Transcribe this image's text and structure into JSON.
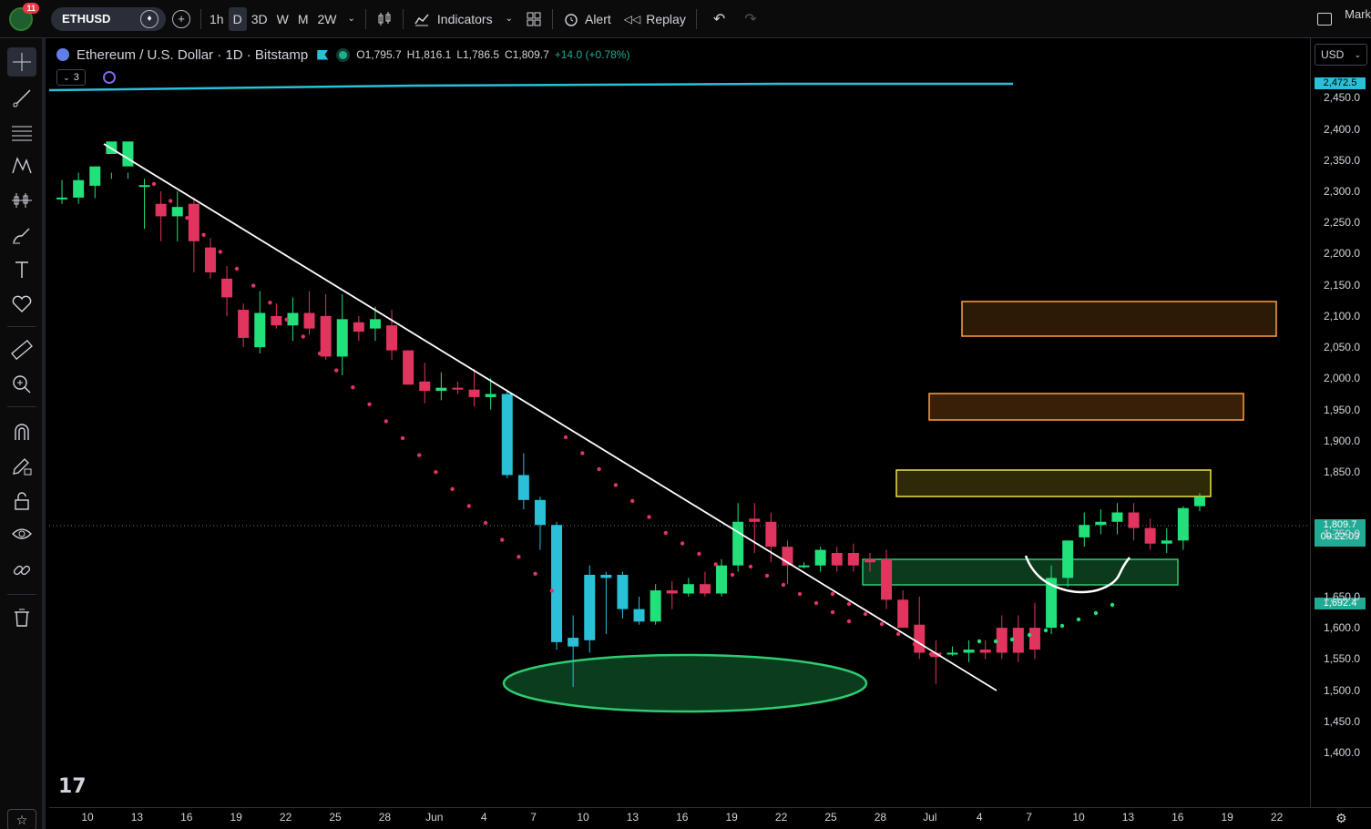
{
  "toolbar": {
    "notif_count": "11",
    "symbol": "ETHUSD",
    "timeframes": [
      "1h",
      "D",
      "3D",
      "W",
      "M",
      "2W"
    ],
    "active_timeframe": "D",
    "indicators_label": "Indicators",
    "alert_label": "Alert",
    "replay_label": "Replay",
    "right_label": "Mark"
  },
  "legend": {
    "title": "Ethereum / U.S. Dollar · 1D · Bitstamp",
    "open": "O1,795.7",
    "high": "H1,816.1",
    "low": "L1,786.5",
    "close": "C1,809.7",
    "change": "+14.0 (+0.78%)",
    "indicator_count": "3"
  },
  "currency": "USD",
  "price_axis": {
    "labels": [
      "2,450.0",
      "2,400.0",
      "2,350.0",
      "2,300.0",
      "2,250.0",
      "2,200.0",
      "2,150.0",
      "2,100.0",
      "2,050.0",
      "2,000.0",
      "1,950.0",
      "1,900.0",
      "1,850.0",
      "1,750.0",
      "1,650.0",
      "1,600.0",
      "1,550.0",
      "1,500.0",
      "1,450.0",
      "1,400.0"
    ],
    "tag_top": "2,472.5",
    "tag_price": "1,809.7",
    "tag_countdown": "09:22:09",
    "tag_low": "1,692.4"
  },
  "time_axis": [
    "10",
    "13",
    "16",
    "19",
    "22",
    "25",
    "28",
    "Jun",
    "4",
    "7",
    "10",
    "13",
    "16",
    "19",
    "22",
    "25",
    "28",
    "Jul",
    "4",
    "7",
    "10",
    "13",
    "16",
    "19",
    "22"
  ],
  "colors": {
    "up": "#22e07a",
    "down": "#e0355f",
    "up_blue": "#2ac1d8",
    "bg": "#000000",
    "ellipse": "#2ecc71",
    "zone_orange": "#ff9f43",
    "zone_yellow": "#f1e04a",
    "zone_green": "#2ecc71"
  },
  "chart_data": {
    "type": "candlestick",
    "ylim": [
      1380,
      2520
    ],
    "candles": [
      [
        1,
        2290,
        2290,
        2280,
        2318
      ],
      [
        2,
        2290,
        2318,
        2280,
        2330
      ],
      [
        3,
        2309,
        2340,
        2289,
        2340
      ],
      [
        4,
        2360,
        2380,
        2320,
        2330
      ],
      [
        5,
        2340,
        2380,
        2320,
        2330
      ],
      [
        6,
        2310,
        2310,
        2240,
        2320
      ],
      [
        7,
        2280,
        2260,
        2220,
        2300
      ],
      [
        8,
        2260,
        2275,
        2220,
        2300
      ],
      [
        9,
        2280,
        2220,
        2170,
        2290
      ],
      [
        10,
        2210,
        2170,
        2160,
        2225
      ],
      [
        11,
        2160,
        2130,
        2100,
        2180
      ],
      [
        12,
        2110,
        2065,
        2050,
        2120
      ],
      [
        13,
        2050,
        2105,
        2040,
        2140
      ],
      [
        14,
        2100,
        2085,
        2080,
        2120
      ],
      [
        15,
        2085,
        2105,
        2060,
        2130
      ],
      [
        16,
        2105,
        2080,
        2070,
        2140
      ],
      [
        17,
        2100,
        2035,
        2030,
        2135
      ],
      [
        18,
        2035,
        2095,
        2005,
        2135
      ],
      [
        19,
        2090,
        2075,
        2060,
        2100
      ],
      [
        20,
        2080,
        2095,
        2060,
        2115
      ],
      [
        21,
        2085,
        2045,
        2030,
        2110
      ],
      [
        22,
        2045,
        1990,
        1995,
        2045
      ],
      [
        23,
        1995,
        1980,
        1960,
        2025
      ],
      [
        24,
        1980,
        1985,
        1965,
        2010
      ],
      [
        25,
        1985,
        1982,
        1975,
        1995
      ],
      [
        26,
        1982,
        1970,
        1955,
        2015
      ],
      [
        27,
        1970,
        1975,
        1950,
        2000
      ],
      [
        28,
        1975,
        1845,
        1840,
        1980
      ],
      [
        29,
        1845,
        1805,
        1790,
        1880
      ],
      [
        30,
        1805,
        1765,
        1725,
        1810
      ],
      [
        31,
        1765,
        1577,
        1565,
        1770
      ],
      [
        32,
        1570,
        1584,
        1505,
        1620
      ],
      [
        33,
        1580,
        1685,
        1560,
        1700
      ],
      [
        34,
        1680,
        1685,
        1590,
        1690
      ],
      [
        35,
        1685,
        1630,
        1615,
        1690
      ],
      [
        36,
        1630,
        1610,
        1605,
        1650
      ],
      [
        37,
        1610,
        1660,
        1605,
        1670
      ],
      [
        38,
        1660,
        1655,
        1630,
        1675
      ],
      [
        39,
        1655,
        1670,
        1650,
        1680
      ],
      [
        40,
        1670,
        1655,
        1650,
        1690
      ],
      [
        41,
        1655,
        1700,
        1650,
        1710
      ],
      [
        42,
        1700,
        1770,
        1690,
        1800
      ],
      [
        43,
        1775,
        1770,
        1720,
        1800
      ],
      [
        44,
        1770,
        1730,
        1705,
        1785
      ],
      [
        45,
        1730,
        1700,
        1670,
        1740
      ],
      [
        46,
        1700,
        1700,
        1695,
        1705
      ],
      [
        47,
        1700,
        1725,
        1690,
        1730
      ],
      [
        48,
        1720,
        1700,
        1690,
        1730
      ],
      [
        49,
        1720,
        1700,
        1690,
        1735
      ],
      [
        50,
        1710,
        1705,
        1690,
        1720
      ],
      [
        51,
        1710,
        1645,
        1630,
        1725
      ],
      [
        52,
        1645,
        1600,
        1600,
        1660
      ],
      [
        53,
        1605,
        1560,
        1550,
        1650
      ],
      [
        54,
        1560,
        1553,
        1510,
        1580
      ],
      [
        55,
        1560,
        1560,
        1555,
        1570
      ],
      [
        56,
        1560,
        1565,
        1545,
        1580
      ],
      [
        57,
        1565,
        1560,
        1550,
        1580
      ],
      [
        58,
        1600,
        1560,
        1550,
        1620
      ],
      [
        59,
        1600,
        1560,
        1545,
        1620
      ],
      [
        60,
        1600,
        1565,
        1550,
        1640
      ],
      [
        61,
        1600,
        1680,
        1590,
        1700
      ],
      [
        62,
        1680,
        1740,
        1665,
        1740
      ],
      [
        63,
        1745,
        1765,
        1730,
        1785
      ],
      [
        64,
        1765,
        1770,
        1750,
        1790
      ],
      [
        65,
        1770,
        1785,
        1750,
        1800
      ],
      [
        66,
        1785,
        1760,
        1740,
        1800
      ],
      [
        67,
        1760,
        1735,
        1725,
        1775
      ],
      [
        68,
        1735,
        1740,
        1720,
        1760
      ],
      [
        69,
        1740,
        1792,
        1725,
        1795
      ],
      [
        70,
        1795,
        1810,
        1787,
        1816
      ]
    ]
  }
}
